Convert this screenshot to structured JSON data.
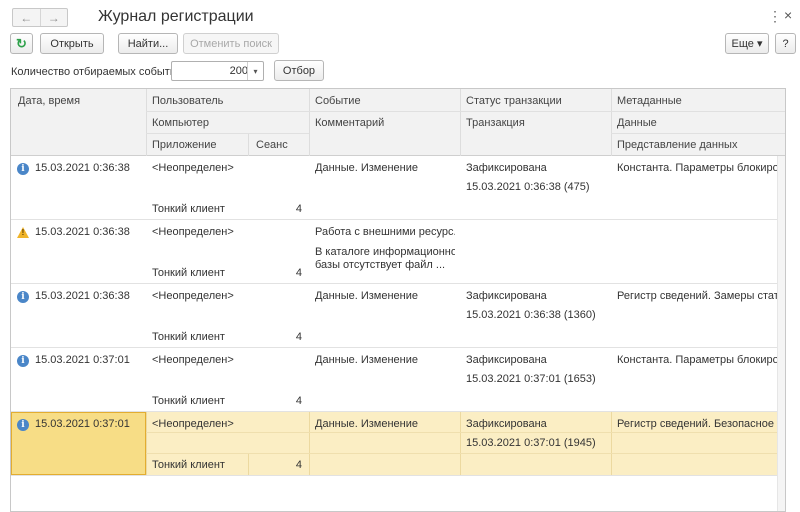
{
  "window": {
    "title": "Журнал регистрации",
    "back_icon": "arrow-left-icon",
    "forward_icon": "arrow-right-icon",
    "back_glyph": "←",
    "forward_glyph": "→",
    "menu_glyph": "⋮",
    "close_glyph": "×"
  },
  "toolbar": {
    "refresh_glyph": "↻",
    "open_label": "Открыть",
    "find_label": "Найти...",
    "cancel_search_label": "Отменить поиск",
    "more_label": "Еще ▾",
    "help_label": "?"
  },
  "count": {
    "label": "Количество отбираемых событий:",
    "value": "200",
    "dropdown_glyph": "▾",
    "filter_label": "Отбор"
  },
  "columns": {
    "date": "Дата, время",
    "user": "Пользователь",
    "computer": "Компьютер",
    "application": "Приложение",
    "session": "Сеанс",
    "event": "Событие",
    "comment": "Комментарий",
    "status": "Статус транзакции",
    "transaction": "Транзакция",
    "metadata": "Метаданные",
    "data": "Данные",
    "data_presentation": "Представление данных"
  },
  "rows": [
    {
      "level": "info",
      "date": "15.03.2021 0:36:38",
      "user": "<Неопределен>",
      "application": "Тонкий клиент",
      "session": "4",
      "event": "Данные. Изменение",
      "comment": "",
      "comment2": "",
      "status": "Зафиксирована",
      "transaction": "15.03.2021 0:36:38 (475)",
      "metadata": "Константа. Параметры блокировк..."
    },
    {
      "level": "warning",
      "date": "15.03.2021 0:36:38",
      "user": "<Неопределен>",
      "application": "Тонкий клиент",
      "session": "4",
      "event": "Работа с внешними ресурс...",
      "comment": "В каталоге информационной",
      "comment2": "базы отсутствует файл ...",
      "status": "",
      "transaction": "",
      "metadata": ""
    },
    {
      "level": "info",
      "date": "15.03.2021 0:36:38",
      "user": "<Неопределен>",
      "application": "Тонкий клиент",
      "session": "4",
      "event": "Данные. Изменение",
      "comment": "",
      "comment2": "",
      "status": "Зафиксирована",
      "transaction": "15.03.2021 0:36:38 (1360)",
      "metadata": "Регистр сведений. Замеры стати..."
    },
    {
      "level": "info",
      "date": "15.03.2021 0:37:01",
      "user": "<Неопределен>",
      "application": "Тонкий клиент",
      "session": "4",
      "event": "Данные. Изменение",
      "comment": "",
      "comment2": "",
      "status": "Зафиксирована",
      "transaction": "15.03.2021 0:37:01 (1653)",
      "metadata": "Константа. Параметры блокировк..."
    },
    {
      "level": "info",
      "date": "15.03.2021 0:37:01",
      "user": "<Неопределен>",
      "application": "Тонкий клиент",
      "session": "4",
      "event": "Данные. Изменение",
      "comment": "",
      "comment2": "",
      "status": "Зафиксирована",
      "transaction": "15.03.2021 0:37:01 (1945)",
      "metadata": "Регистр сведений. Безопасное хр..."
    }
  ],
  "selected_row": 4,
  "colors": {
    "selected_row": "#fbeec4",
    "selected_cell": "#f7dd86",
    "info_icon": "#4a86c8",
    "warning_icon": "#f0b429",
    "refresh_icon": "#2ea14a"
  }
}
